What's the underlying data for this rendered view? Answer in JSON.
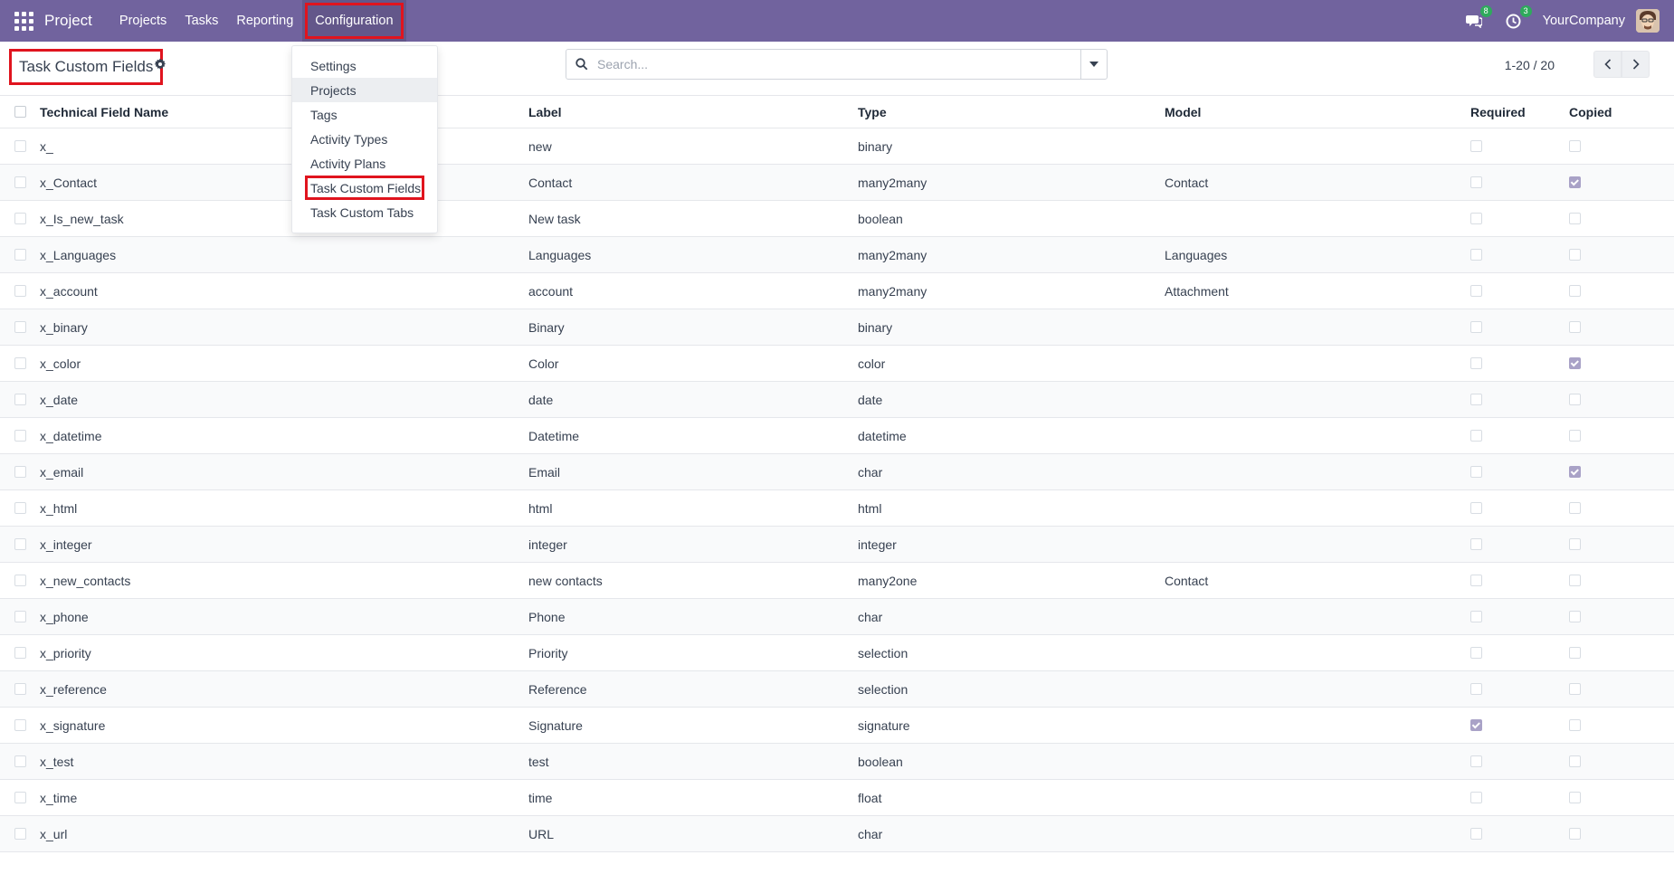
{
  "navbar": {
    "brand": "Project",
    "menu": [
      "Projects",
      "Tasks",
      "Reporting",
      "Configuration"
    ],
    "messages_badge": "8",
    "activity_badge": "3",
    "company": "YourCompany",
    "bg_color": "#71639e"
  },
  "control": {
    "title": "Task Custom Fields",
    "search_placeholder": "Search...",
    "pager": "1-20 / 20"
  },
  "dropdown": {
    "items": [
      "Settings",
      "Projects",
      "Tags",
      "Activity Types",
      "Activity Plans",
      "Task Custom Fields",
      "Task Custom Tabs"
    ]
  },
  "table": {
    "headers": [
      "Technical Field Name",
      "Label",
      "Type",
      "Model",
      "Required",
      "Copied"
    ],
    "rows": [
      {
        "name": "x_",
        "label": "new",
        "type": "binary",
        "model": "",
        "required": false,
        "copied": false
      },
      {
        "name": "x_Contact",
        "label": "Contact",
        "type": "many2many",
        "model": "Contact",
        "required": false,
        "copied": true
      },
      {
        "name": "x_Is_new_task",
        "label": "New task",
        "type": "boolean",
        "model": "",
        "required": false,
        "copied": false
      },
      {
        "name": "x_Languages",
        "label": "Languages",
        "type": "many2many",
        "model": "Languages",
        "required": false,
        "copied": false
      },
      {
        "name": "x_account",
        "label": "account",
        "type": "many2many",
        "model": "Attachment",
        "required": false,
        "copied": false
      },
      {
        "name": "x_binary",
        "label": "Binary",
        "type": "binary",
        "model": "",
        "required": false,
        "copied": false
      },
      {
        "name": "x_color",
        "label": "Color",
        "type": "color",
        "model": "",
        "required": false,
        "copied": true
      },
      {
        "name": "x_date",
        "label": "date",
        "type": "date",
        "model": "",
        "required": false,
        "copied": false
      },
      {
        "name": "x_datetime",
        "label": "Datetime",
        "type": "datetime",
        "model": "",
        "required": false,
        "copied": false
      },
      {
        "name": "x_email",
        "label": "Email",
        "type": "char",
        "model": "",
        "required": false,
        "copied": true
      },
      {
        "name": "x_html",
        "label": "html",
        "type": "html",
        "model": "",
        "required": false,
        "copied": false
      },
      {
        "name": "x_integer",
        "label": "integer",
        "type": "integer",
        "model": "",
        "required": false,
        "copied": false
      },
      {
        "name": "x_new_contacts",
        "label": "new contacts",
        "type": "many2one",
        "model": "Contact",
        "required": false,
        "copied": false
      },
      {
        "name": "x_phone",
        "label": "Phone",
        "type": "char",
        "model": "",
        "required": false,
        "copied": false
      },
      {
        "name": "x_priority",
        "label": "Priority",
        "type": "selection",
        "model": "",
        "required": false,
        "copied": false
      },
      {
        "name": "x_reference",
        "label": "Reference",
        "type": "selection",
        "model": "",
        "required": false,
        "copied": false
      },
      {
        "name": "x_signature",
        "label": "Signature",
        "type": "signature",
        "model": "",
        "required": true,
        "copied": false
      },
      {
        "name": "x_test",
        "label": "test",
        "type": "boolean",
        "model": "",
        "required": false,
        "copied": false
      },
      {
        "name": "x_time",
        "label": "time",
        "type": "float",
        "model": "",
        "required": false,
        "copied": false
      },
      {
        "name": "x_url",
        "label": "URL",
        "type": "char",
        "model": "",
        "required": false,
        "copied": false
      }
    ]
  }
}
